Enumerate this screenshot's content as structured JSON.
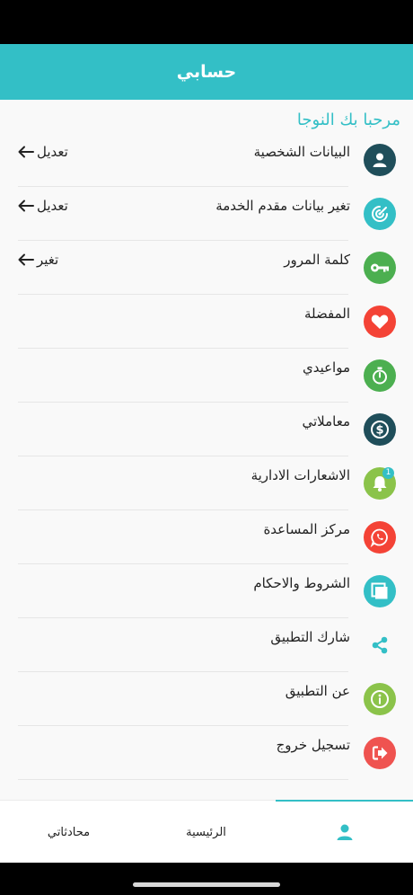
{
  "header": {
    "title": "حسابي"
  },
  "greeting": "مرحبا بك  النوجا",
  "menu": [
    {
      "label": "البيانات الشخصية",
      "action": "تعديل",
      "icon": "person-icon",
      "color": "#1f4e5a"
    },
    {
      "label": "تغير بيانات مقدم الخدمة",
      "action": "تعديل",
      "icon": "radar-icon",
      "color": "#33bfc6"
    },
    {
      "label": "كلمة المرور",
      "action": "تغير",
      "icon": "key-icon",
      "color": "#4caf50"
    },
    {
      "label": "المفضلة",
      "icon": "heart-icon",
      "color": "#f44336"
    },
    {
      "label": "مواعيدي",
      "icon": "timer-icon",
      "color": "#4caf50"
    },
    {
      "label": "معاملاتي",
      "icon": "dollar-icon",
      "color": "#1f4e5a"
    },
    {
      "label": "الاشعارات الادارية",
      "icon": "bell-icon",
      "color": "#8bc34a",
      "badge": "1"
    },
    {
      "label": "مركز المساعدة",
      "icon": "whatsapp-icon",
      "color": "#f44336"
    },
    {
      "label": "الشروط والاحكام",
      "icon": "pages-icon",
      "color": "#33bfc6"
    },
    {
      "label": "شارك التطبيق",
      "icon": "share-icon",
      "color": "#33bfc6"
    },
    {
      "label": "عن التطبيق",
      "icon": "info-icon",
      "color": "#8bc34a"
    },
    {
      "label": "تسجيل خروج",
      "icon": "logout-icon",
      "color": "#ef5350"
    }
  ],
  "bottom_nav": [
    {
      "label": "محادثاتي"
    },
    {
      "label": "الرئيسية"
    },
    {
      "icon": "person-icon",
      "active": true
    }
  ],
  "colors": {
    "accent": "#33bfc6"
  }
}
